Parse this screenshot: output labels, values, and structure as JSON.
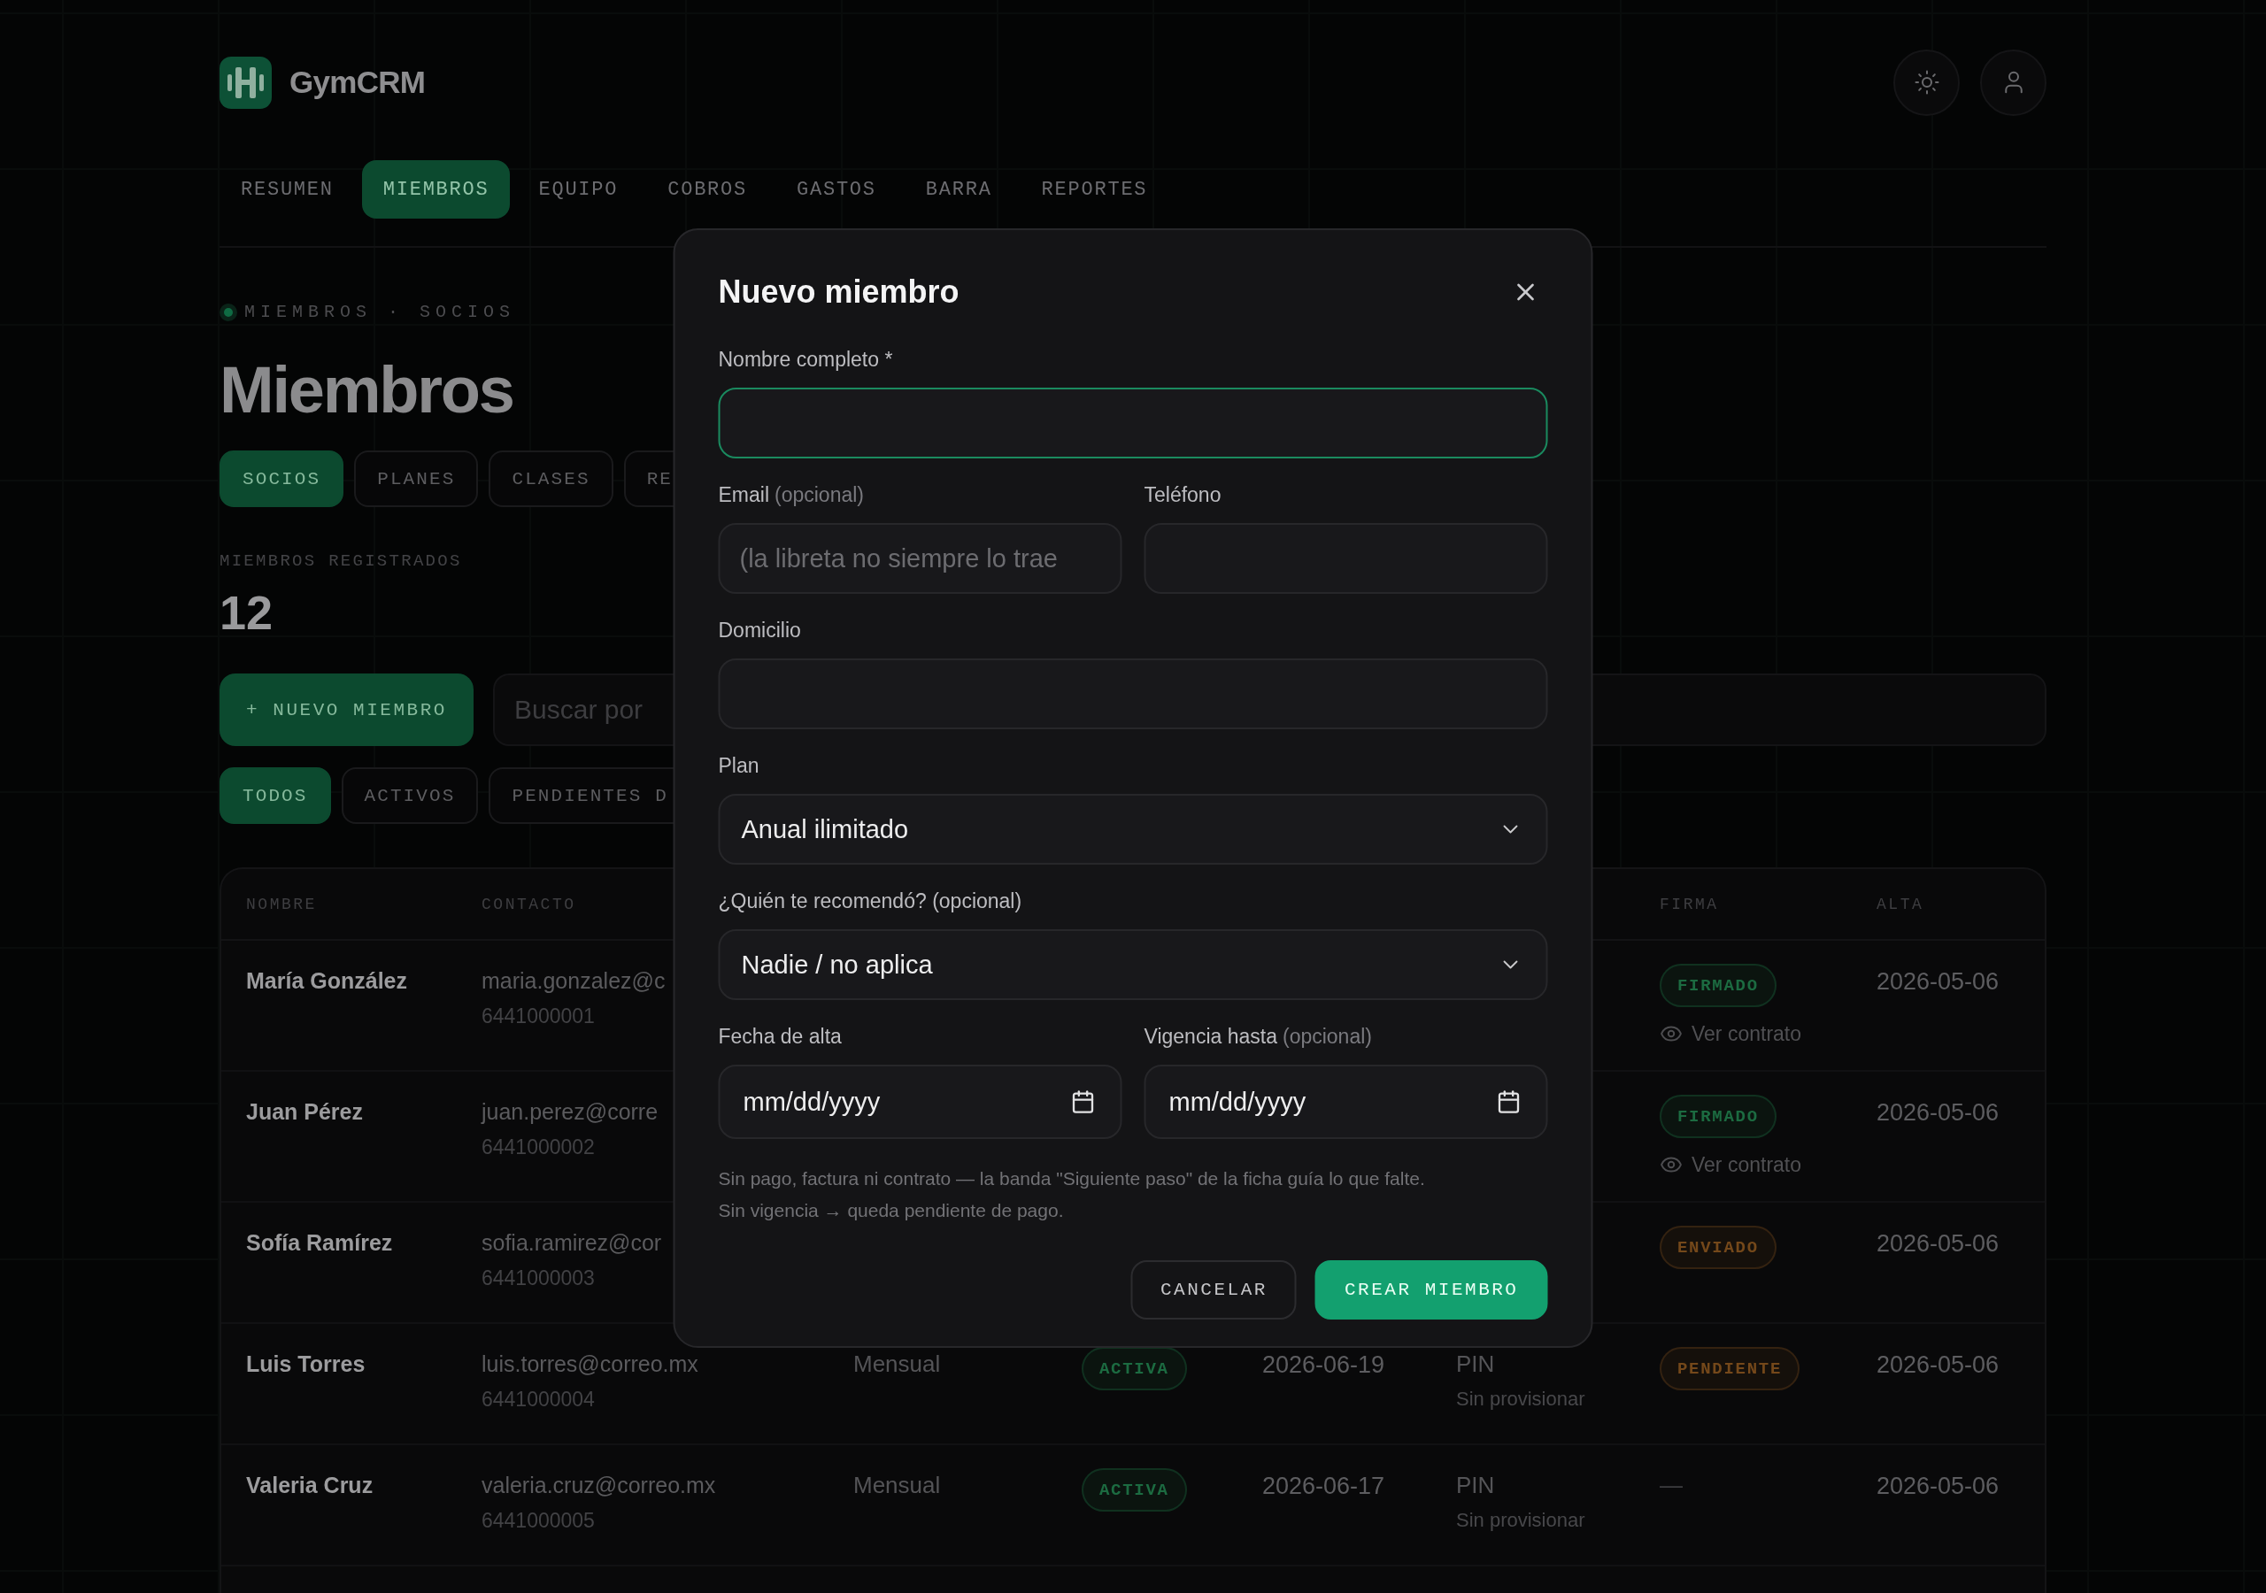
{
  "brand": {
    "name": "GymCRM"
  },
  "nav": [
    {
      "label": "RESUMEN",
      "selected": false
    },
    {
      "label": "MIEMBROS",
      "selected": true
    },
    {
      "label": "EQUIPO",
      "selected": false
    },
    {
      "label": "COBROS",
      "selected": false
    },
    {
      "label": "GASTOS",
      "selected": false
    },
    {
      "label": "BARRA",
      "selected": false
    },
    {
      "label": "REPORTES",
      "selected": false
    }
  ],
  "breadcrumb": "MIEMBROS · SOCIOS",
  "page_title": "Miembros",
  "section_tabs": [
    {
      "label": "SOCIOS",
      "selected": true
    },
    {
      "label": "PLANES",
      "selected": false
    },
    {
      "label": "CLASES",
      "selected": false
    },
    {
      "label": "RE",
      "selected": false
    }
  ],
  "stat": {
    "label": "MIEMBROS REGISTRADOS",
    "value": "12"
  },
  "new_member_button": "+ NUEVO MIEMBRO",
  "search": {
    "placeholder": "Buscar por"
  },
  "filters": [
    {
      "label": "TODOS",
      "selected": true
    },
    {
      "label": "ACTIVOS",
      "selected": false
    },
    {
      "label": "PENDIENTES D",
      "selected": false
    }
  ],
  "table": {
    "columns": {
      "name": "NOMBRE",
      "contact": "CONTACTO",
      "signature": "FIRMA",
      "joined": "ALTA"
    },
    "rows": [
      {
        "name": "María González",
        "email": "maria.gonzalez@c",
        "phone": "6441000001",
        "signature": {
          "kind": "badge",
          "label": "FIRMADO",
          "color": "#1c6b41",
          "link": "Ver contrato"
        },
        "joined": "2026-05-06"
      },
      {
        "name": "Juan Pérez",
        "email": "juan.perez@corre",
        "phone": "6441000002",
        "signature": {
          "kind": "badge",
          "label": "FIRMADO",
          "color": "#1c6b41",
          "link": "Ver contrato"
        },
        "joined": "2026-05-06"
      },
      {
        "name": "Sofía Ramírez",
        "email": "sofia.ramirez@cor",
        "phone": "6441000003",
        "signature": {
          "kind": "badge",
          "label": "ENVIADO",
          "color": "#74481a"
        },
        "joined": "2026-05-06"
      },
      {
        "name": "Luis Torres",
        "email": "luis.torres@correo.mx",
        "phone": "6441000004",
        "column_3": "Mensual",
        "column_4": {
          "label": "ACTIVA",
          "color": "#1c6b41"
        },
        "column_5": "2026-06-19",
        "column_6": {
          "title": "PIN",
          "subtitle": "Sin provisionar"
        },
        "signature": {
          "kind": "badge",
          "label": "PENDIENTE",
          "color": "#74481a"
        },
        "joined": "2026-05-06"
      },
      {
        "name": "Valeria Cruz",
        "email": "valeria.cruz@correo.mx",
        "phone": "6441000005",
        "column_3": "Mensual",
        "column_4": {
          "label": "ACTIVA",
          "color": "#1c6b41"
        },
        "column_5": "2026-06-17",
        "column_6": {
          "title": "PIN",
          "subtitle": "Sin provisionar"
        },
        "signature": {
          "kind": "text",
          "label": "—"
        },
        "joined": "2026-05-06"
      }
    ]
  },
  "dialog": {
    "title": "Nuevo miembro",
    "rows": [
      [
        {
          "kind": "text",
          "label": "Nombre completo *",
          "focused": true
        }
      ],
      [
        {
          "kind": "text",
          "label": "Email",
          "hint": "(opcional)",
          "placeholder": "(la libreta no siempre lo trae",
          "focused": false
        },
        {
          "kind": "text",
          "label": "Teléfono",
          "focused": false
        }
      ],
      [
        {
          "kind": "text",
          "label": "Domicilio",
          "focused": false
        }
      ],
      [
        {
          "kind": "select",
          "label": "Plan",
          "value": "Anual ilimitado",
          "focused": false
        }
      ],
      [
        {
          "kind": "select",
          "label": "¿Quién te recomendó? (opcional)",
          "value": "Nadie / no aplica",
          "focused": false
        }
      ],
      [
        {
          "kind": "date",
          "label": "Fecha de alta",
          "placeholder": "mm/dd/yyyy",
          "focused": false
        },
        {
          "kind": "date",
          "label": "Vigencia hasta",
          "hint": "(opcional)",
          "placeholder": "mm/dd/yyyy",
          "focused": false
        }
      ]
    ],
    "notes": [
      "Sin pago, factura ni contrato — la banda \"Siguiente paso\" de la ficha guía lo que falte.",
      "Sin vigencia → queda pendiente de pago."
    ],
    "buttons": [
      {
        "kind": "secondary",
        "label": "CANCELAR"
      },
      {
        "kind": "primary",
        "label": "CREAR MIEMBRO"
      }
    ]
  }
}
